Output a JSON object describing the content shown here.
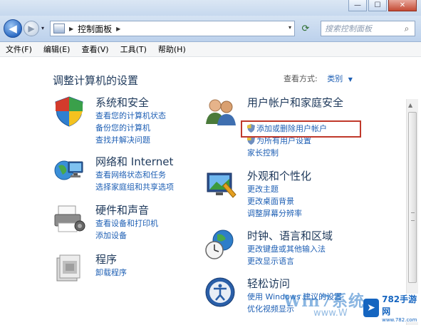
{
  "window": {
    "minimize_glyph": "—",
    "maximize_glyph": "☐",
    "close_glyph": "✕"
  },
  "nav": {
    "back_glyph": "◀",
    "forward_glyph": "▶",
    "dropdown_glyph": "▾",
    "address_separator": "▶",
    "address_crumb": "控制面板",
    "address_drop_glyph": "▾",
    "refresh_glyph": "⟳",
    "search_placeholder": "搜索控制面板",
    "search_glyph": "⌕"
  },
  "menu": {
    "items": [
      "文件(F)",
      "编辑(E)",
      "查看(V)",
      "工具(T)",
      "帮助(H)"
    ]
  },
  "page": {
    "title": "调整计算机的设置",
    "view_by_label": "查看方式:",
    "view_by_value": "类别",
    "view_by_caret": "▼"
  },
  "categories": {
    "system": {
      "title": "系统和安全",
      "links": [
        "查看您的计算机状态",
        "备份您的计算机",
        "查找并解决问题"
      ]
    },
    "network": {
      "title": "网络和 Internet",
      "links": [
        "查看网络状态和任务",
        "选择家庭组和共享选项"
      ]
    },
    "hardware": {
      "title": "硬件和声音",
      "links": [
        "查看设备和打印机",
        "添加设备"
      ]
    },
    "programs": {
      "title": "程序",
      "links": [
        "卸载程序"
      ]
    },
    "users": {
      "title": "用户帐户和家庭安全",
      "links": [
        "添加或删除用户帐户",
        "为所有用户设置家长控制"
      ]
    },
    "appearance": {
      "title": "外观和个性化",
      "links": [
        "更改主题",
        "更改桌面背景",
        "调整屏幕分辨率"
      ]
    },
    "clock": {
      "title": "时钟、语言和区域",
      "links": [
        "更改键盘或其他输入法",
        "更改显示语言"
      ]
    },
    "ease": {
      "title": "轻松访问",
      "links": [
        "使用 Windows 建议的设置",
        "优化视频显示"
      ]
    }
  },
  "scrollbar": {
    "up_glyph": "▲"
  },
  "watermark": {
    "brand": "Win7系统",
    "url": "www.W",
    "badge_logo": "➤",
    "badge_title": "782手游网",
    "badge_sub": "www.782.com"
  },
  "colors": {
    "link": "#1e5fb4",
    "title": "#1e395b",
    "highlight": "#c0392b"
  }
}
